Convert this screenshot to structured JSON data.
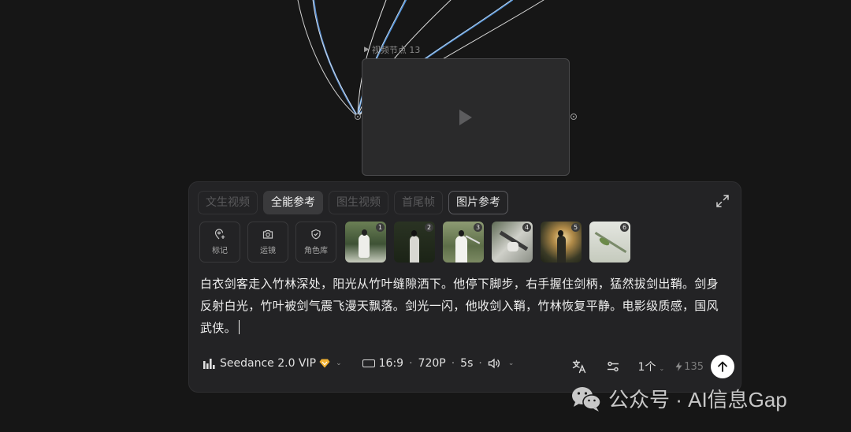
{
  "node": {
    "label": "视频节点 13"
  },
  "tabs": [
    {
      "label": "文生视频",
      "state": "disabled"
    },
    {
      "label": "全能参考",
      "state": "active"
    },
    {
      "label": "图生视频",
      "state": "disabled"
    },
    {
      "label": "首尾帧",
      "state": "disabled"
    },
    {
      "label": "图片参考",
      "state": "outlined"
    }
  ],
  "tools": [
    {
      "label": "标记",
      "icon": "location-pin-plus-icon"
    },
    {
      "label": "运镜",
      "icon": "camera-icon"
    },
    {
      "label": "角色库",
      "icon": "shield-icon"
    }
  ],
  "references": [
    "1",
    "2",
    "3",
    "4",
    "5",
    "6"
  ],
  "prompt": "白衣剑客走入竹林深处，阳光从竹叶缝隙洒下。他停下脚步，右手握住剑柄，猛然拔剑出鞘。剑身反射白光，竹叶被剑气震飞漫天飘落。剑光一闪，他收剑入鞘，竹林恢复平静。电影级质感，国风武侠。",
  "toolbar": {
    "model": "Seedance 2.0 VIP",
    "ratio": "16:9",
    "resolution": "720P",
    "duration": "5s",
    "count": "1个",
    "credits": "135"
  },
  "watermark": "公众号 · AI信息Gap",
  "colors": {
    "panel": "#232325",
    "background": "#161616",
    "wire_accent": "#4d8fd6",
    "vip": "#f2b233"
  }
}
